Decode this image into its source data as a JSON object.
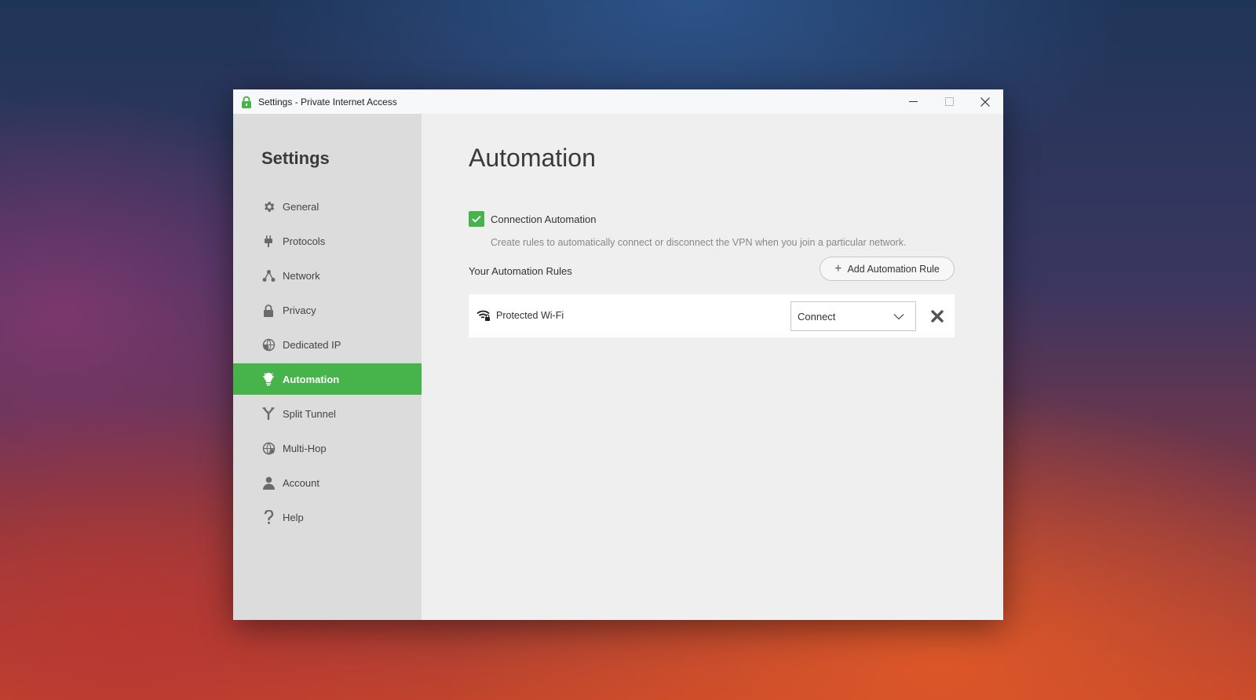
{
  "window": {
    "title": "Settings - Private Internet Access",
    "controls": [
      "minimize",
      "maximize",
      "close"
    ]
  },
  "sidebar": {
    "title": "Settings",
    "items": [
      {
        "label": "General",
        "icon": "gear-icon",
        "active": false
      },
      {
        "label": "Protocols",
        "icon": "plug-icon",
        "active": false
      },
      {
        "label": "Network",
        "icon": "network-icon",
        "active": false
      },
      {
        "label": "Privacy",
        "icon": "lock-icon",
        "active": false
      },
      {
        "label": "Dedicated IP",
        "icon": "dedicated-ip-icon",
        "active": false
      },
      {
        "label": "Automation",
        "icon": "lightbulb-icon",
        "active": true
      },
      {
        "label": "Split Tunnel",
        "icon": "split-icon",
        "active": false
      },
      {
        "label": "Multi-Hop",
        "icon": "globe-icon",
        "active": false
      },
      {
        "label": "Account",
        "icon": "user-icon",
        "active": false
      },
      {
        "label": "Help",
        "icon": "question-icon",
        "active": false
      }
    ]
  },
  "main": {
    "title": "Automation",
    "connection_automation": {
      "label": "Connection Automation",
      "checked": true,
      "description": "Create rules to automatically connect or disconnect the VPN when you join a particular network."
    },
    "rules_heading": "Your Automation Rules",
    "add_rule_label": "Add Automation Rule",
    "rules": [
      {
        "name": "Protected Wi-Fi",
        "icon": "wifi-lock-icon",
        "action": "Connect"
      }
    ]
  },
  "colors": {
    "accent": "#47b34b",
    "sidebar_bg": "#dcdcdc",
    "content_bg": "#efefef"
  }
}
